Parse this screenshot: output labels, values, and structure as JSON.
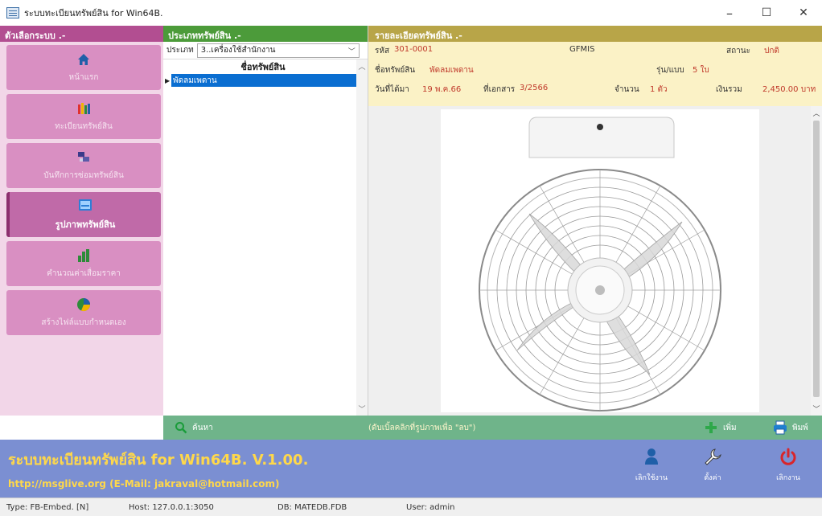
{
  "window": {
    "title": "ระบบทะเบียนทรัพย์สิน for Win64B.",
    "controls": {
      "minimize": "–",
      "maximize": "☐",
      "close": "✕"
    }
  },
  "sidebar": {
    "header": "ตัวเลือกระบบ .-",
    "items": [
      {
        "label": "หน้าแรก",
        "icon": "home-icon",
        "active": false
      },
      {
        "label": "ทะเบียนทรัพย์สิน",
        "icon": "books-icon",
        "active": false
      },
      {
        "label": "บันทึกการซ่อมทรัพย์สิน",
        "icon": "repair-icon",
        "active": false
      },
      {
        "label": "รูปภาพทรัพย์สิน",
        "icon": "image-icon",
        "active": true
      },
      {
        "label": "คำนวณค่าเสื่อมราคา",
        "icon": "bar-chart-icon",
        "active": false
      },
      {
        "label": "สร้างไฟล์แบบกำหนดเอง",
        "icon": "pie-chart-icon",
        "active": false
      }
    ]
  },
  "asset_types": {
    "header": "ประเภททรัพย์สิน .-",
    "type_label": "ประเภท",
    "type_value": "3..เครื่องใช้สำนักงาน",
    "column_header": "ชื่อทรัพย์สิน",
    "rows": [
      "พัดลมเพดาน"
    ]
  },
  "detail": {
    "header": "รายละเอียดทรัพย์สิน .-",
    "code_label": "รหัส",
    "code_value": "301-0001",
    "gfmis": "GFMIS",
    "status_label": "สถานะ",
    "status_value": "ปกติ",
    "name_label": "ชื่อทรัพย์สิน",
    "name_value": "พัดลมเพดาน",
    "model_label": "รุ่น/แบบ",
    "model_value": "5 ใบ",
    "date_label": "วันที่ได้มา",
    "date_value": "19 พ.ค.66",
    "doc_label": "ที่เอกสาร",
    "doc_value": "3/2566",
    "qty_label": "จำนวน",
    "qty_value": "1 ตัว",
    "total_label": "เงินรวม",
    "total_value": "2,450.00 บาท"
  },
  "toolbar": {
    "search": "ค้นหา",
    "hint": "(ดับเบิ้ลคลิกที่รูปภาพเพื่อ \"ลบ\")",
    "add": "เพิ่ม",
    "print": "พิมพ์"
  },
  "banner": {
    "title": "ระบบทะเบียนทรัพย์สิน for Win64B. V.1.00.",
    "contact": "http://msglive.org (E-Mail: jakraval@hotmail.com)",
    "buttons": [
      {
        "label": "เลิกใช้งาน",
        "icon": "user-icon"
      },
      {
        "label": "ตั้งค่า",
        "icon": "wrench-icon"
      },
      {
        "label": "เลิกงาน",
        "icon": "power-icon"
      }
    ]
  },
  "status": {
    "type": "Type: FB-Embed. [N]",
    "host": "Host: 127.0.0.1:3050",
    "db": "DB: MATEDB.FDB",
    "user": "User: admin"
  },
  "colors": {
    "sidebar_header": "#b24e91",
    "mid_header": "#4c9b3a",
    "right_header": "#b8a548",
    "info_bar": "#fbf2c6",
    "banner": "#7b8fd2",
    "banner_text": "#ffd84a",
    "selected_row": "#0a6ed1"
  }
}
